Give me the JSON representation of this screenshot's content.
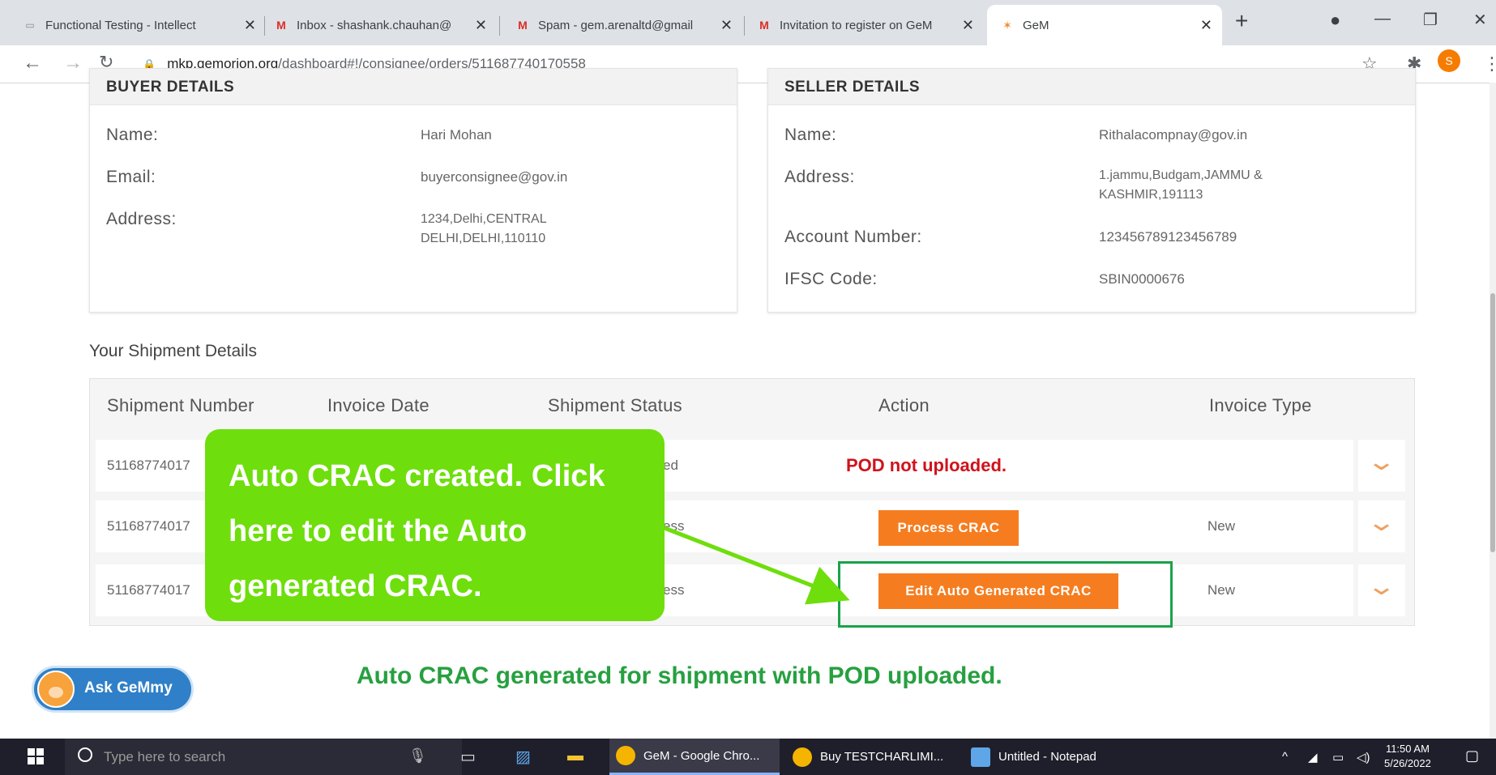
{
  "browser": {
    "tabs": [
      {
        "title": "Functional Testing - Intellect",
        "icon": "doc-icon"
      },
      {
        "title": "Inbox - shashank.chauhan@",
        "icon": "gmail-icon"
      },
      {
        "title": "Spam - gem.arenaltd@gmail",
        "icon": "gmail-icon"
      },
      {
        "title": "Invitation to register on GeM",
        "icon": "gmail-icon"
      },
      {
        "title": "GeM",
        "icon": "gem-icon"
      }
    ],
    "url_domain": "mkp.gemorion.org",
    "url_path": "/dashboard#!/consignee/orders/511687740170558",
    "profile_initial": "S"
  },
  "buyer": {
    "header": "BUYER DETAILS",
    "name_label": "Name:",
    "name": "Hari Mohan",
    "email_label": "Email:",
    "email": "buyerconsignee@gov.in",
    "address_label": "Address:",
    "address_line1": "1234,Delhi,CENTRAL",
    "address_line2": "DELHI,DELHI,110110"
  },
  "seller": {
    "header": "SELLER DETAILS",
    "name_label": "Name:",
    "name": "Rithalacompnay@gov.in",
    "address_label": "Address:",
    "address_line1": "1.jammu,Budgam,JAMMU &",
    "address_line2": "KASHMIR,191113",
    "account_label": "Account Number:",
    "account": "123456789123456789",
    "ifsc_label": "IFSC Code:",
    "ifsc": "SBIN0000676"
  },
  "shipments": {
    "title": "Your Shipment Details",
    "headers": [
      "Shipment Number",
      "Invoice Date",
      "Shipment Status",
      "Action",
      "Invoice Type"
    ],
    "rows": [
      {
        "number": "51168774017",
        "status_fragment": "ed",
        "action": "POD not uploaded.",
        "invoice_type": ""
      },
      {
        "number": "51168774017",
        "status_fragment": "ess",
        "action": "Process CRAC",
        "invoice_type": "New"
      },
      {
        "number": "51168774017",
        "status_fragment": "ess",
        "action": "Edit Auto Generated CRAC",
        "invoice_type": "New"
      }
    ]
  },
  "callout": {
    "line1": "Auto CRAC created. Click",
    "line2": "here to edit the Auto",
    "line3": "generated CRAC."
  },
  "bottom_note": "Auto CRAC generated for shipment with POD uploaded.",
  "assistant": {
    "label": "Ask GeMmy"
  },
  "taskbar": {
    "search_placeholder": "Type here to search",
    "apps": [
      {
        "label": "GeM - Google Chro...",
        "color": "#f4b400"
      },
      {
        "label": "Buy TESTCHARLIMI...",
        "color": "#f4b400"
      },
      {
        "label": "Untitled - Notepad",
        "color": "#5ea6e8"
      }
    ],
    "time": "11:50 AM",
    "date": "5/26/2022"
  },
  "colors": {
    "accent_orange": "#f57d20",
    "callout_green": "#6ede0c",
    "note_green": "#27a040",
    "alert_red": "#d0121b"
  }
}
